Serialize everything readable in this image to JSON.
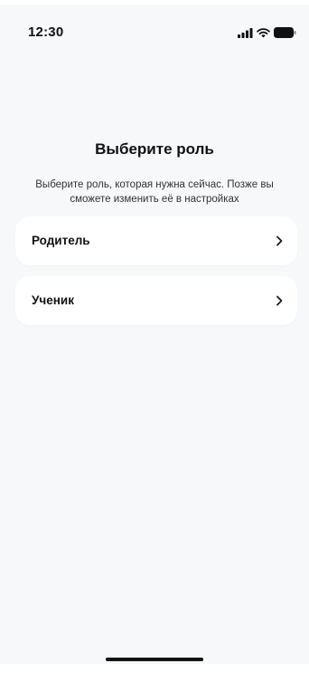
{
  "status_bar": {
    "time": "12:30",
    "icons": [
      "cellular-signal-icon",
      "wifi-icon",
      "battery-icon"
    ]
  },
  "screen": {
    "title": "Выберите роль",
    "subtitle_line1": "Выберите роль, которая нужна сейчас. Позже вы",
    "subtitle_line2": "сможете изменить её в настройках"
  },
  "roles": [
    {
      "label": "Родитель",
      "icon": "chevron-right-icon"
    },
    {
      "label": "Ученик",
      "icon": "chevron-right-icon"
    }
  ],
  "colors": {
    "background": "#f7f8fa",
    "card": "#ffffff",
    "text": "#111111"
  }
}
